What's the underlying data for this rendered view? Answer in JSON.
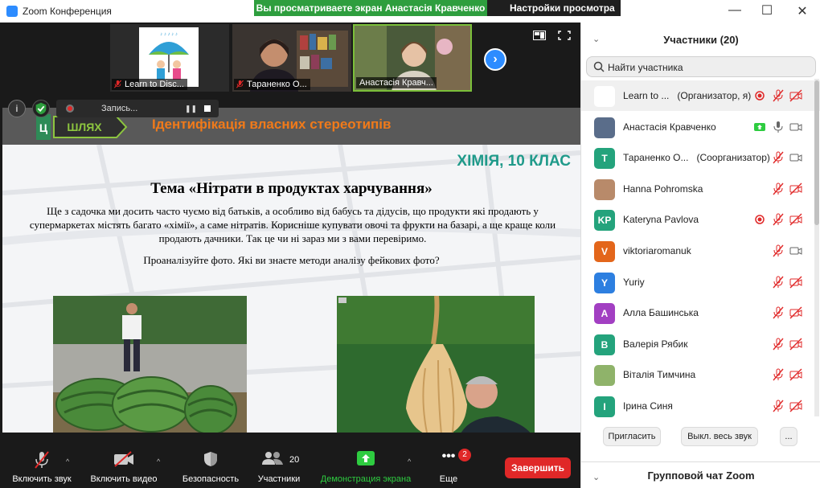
{
  "window": {
    "title": "Zoom Конференция",
    "share_banner": "Вы просматриваете экран Анастасія Кравченко",
    "view_options": "Настройки просмотра"
  },
  "thumbnails": [
    {
      "name": "Learn to Disc...",
      "muted": true,
      "active": false
    },
    {
      "name": "Тараненко О...",
      "muted": true,
      "active": false
    },
    {
      "name": "Анастасія Кравч...",
      "muted": false,
      "active": true
    }
  ],
  "recording": {
    "label": "Запись...",
    "info_glyph": "i",
    "pause_glyph": "❚❚"
  },
  "slide": {
    "header_title": "Ідентифікація власних стереотипів",
    "logo_text": "ШЛЯХ",
    "logo_letter": "Ц",
    "subject": "ХІМІЯ, 10 КЛАС",
    "topic": "Тема «Нітрати в продуктах харчування»",
    "body": "Ще з садочка ми досить часто чуємо від батьків, а особливо від бабусь та дідусів, що продукти які продають у супермаркетах містять багато «хімії», а саме нітратів. Корисніше купувати овочі та фрукти на базарі, а ще краще коли продають дачники. Так це чи ні зараз ми з вами перевіримо.",
    "question": "Проаналізуйте фото. Які ви знаєте методи аналізу фейкових фото?"
  },
  "toolbar": {
    "mute": "Включить звук",
    "video": "Включить видео",
    "security": "Безопасность",
    "participants": "Участники",
    "participants_count": "20",
    "share": "Демонстрация экрана",
    "more": "Еще",
    "more_badge": "2",
    "end": "Завершить"
  },
  "panel": {
    "title": "Участники (20)",
    "search_placeholder": "Найти участника",
    "participants": [
      {
        "name": "Learn to ...",
        "role": "(Организатор, я)",
        "initials": "",
        "color": "#ffffff",
        "avatar": "image",
        "recording": true,
        "mic": "muted",
        "video": "off",
        "sharing": false
      },
      {
        "name": "Анастасія Кравченко",
        "role": "",
        "initials": "",
        "color": "#5a6d8a",
        "avatar": "image",
        "recording": false,
        "mic": "on",
        "video": "on",
        "sharing": true
      },
      {
        "name": "Тараненко О...",
        "role": "(Соорганизатор)",
        "initials": "T",
        "color": "#24a37c",
        "avatar": "letter",
        "recording": false,
        "mic": "muted",
        "video": "on",
        "sharing": false
      },
      {
        "name": "Hanna Pohromska",
        "role": "",
        "initials": "",
        "color": "#b88a6a",
        "avatar": "image",
        "recording": false,
        "mic": "muted",
        "video": "off",
        "sharing": false
      },
      {
        "name": "Kateryna Pavlova",
        "role": "",
        "initials": "KP",
        "color": "#24a37c",
        "avatar": "letter",
        "recording": true,
        "mic": "muted",
        "video": "off",
        "sharing": false
      },
      {
        "name": "viktoriaromanuk",
        "role": "",
        "initials": "V",
        "color": "#e3661b",
        "avatar": "letter",
        "recording": false,
        "mic": "muted",
        "video": "on",
        "sharing": false
      },
      {
        "name": "Yuriy",
        "role": "",
        "initials": "Y",
        "color": "#2d7fe0",
        "avatar": "letter",
        "recording": false,
        "mic": "muted",
        "video": "off",
        "sharing": false
      },
      {
        "name": "Алла Башинська",
        "role": "",
        "initials": "A",
        "color": "#a23fc2",
        "avatar": "letter",
        "recording": false,
        "mic": "muted",
        "video": "off",
        "sharing": false
      },
      {
        "name": "Валерія Рябик",
        "role": "",
        "initials": "B",
        "color": "#24a37c",
        "avatar": "letter",
        "recording": false,
        "mic": "muted",
        "video": "off",
        "sharing": false
      },
      {
        "name": "Віталія Тимчина",
        "role": "",
        "initials": "",
        "color": "#8fb36a",
        "avatar": "image",
        "recording": false,
        "mic": "muted",
        "video": "off",
        "sharing": false
      },
      {
        "name": "Ірина Синя",
        "role": "",
        "initials": "I",
        "color": "#24a37c",
        "avatar": "letter",
        "recording": false,
        "mic": "muted",
        "video": "off",
        "sharing": false
      }
    ],
    "invite": "Пригласить",
    "mute_all": "Выкл. весь звук",
    "more": "...",
    "chat_title": "Групповой чат Zoom"
  },
  "colors": {
    "accent": "#2d8cff",
    "share_green": "#2e9e3e",
    "end_red": "#e02828",
    "muted_red": "#e02828",
    "slide_orange": "#f07a1a",
    "slide_teal": "#1f9a8a"
  }
}
